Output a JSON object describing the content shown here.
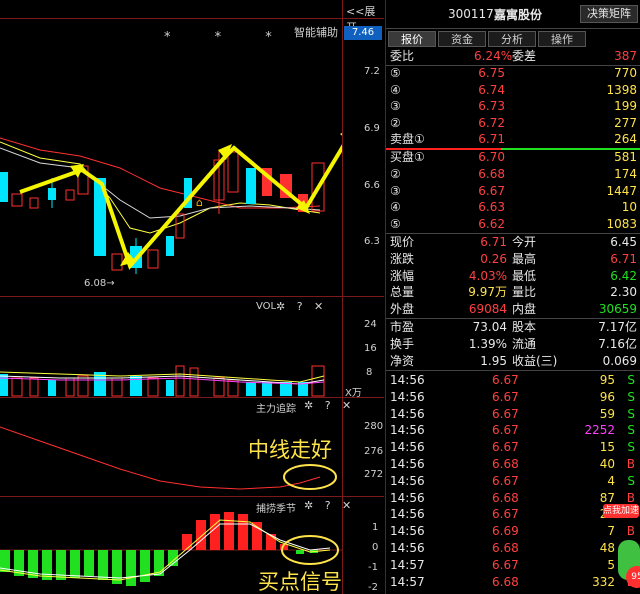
{
  "chart": {
    "expand_label": "<<展开",
    "smart_assist_label": "智能辅助",
    "current_price_badge": "7.46",
    "stars": "*  * *",
    "low_marker": "6.08→",
    "price_axis": [
      "7.2",
      "6.9",
      "6.6",
      "6.3"
    ],
    "vol_panel": {
      "title": "VOL",
      "axis": [
        "24",
        "16",
        "8"
      ],
      "unit": "X万"
    },
    "main_force_panel": {
      "title": "主力追踪",
      "axis": [
        "280",
        "276",
        "272"
      ]
    },
    "season_panel": {
      "title": "捕捞季节",
      "axis": [
        "1",
        "0",
        "-1",
        "-2"
      ]
    },
    "panel_icons": "✲ ? ✕",
    "annotation_midline": "中线走好",
    "annotation_buy": "买点信号",
    "colors": {
      "up": "#ff2a2a",
      "down": "#00e5ff",
      "ma_yellow": "#ffff40",
      "arrow": "#f5f500"
    }
  },
  "quote": {
    "code": "300117",
    "name": "嘉寓股份",
    "matrix_button": "决策矩阵",
    "tabs": [
      "报价",
      "资金",
      "分析",
      "操作"
    ],
    "commission": {
      "label1": "委比",
      "value1": "6.24%",
      "label2": "委差",
      "value2": "387"
    },
    "sell_orders": [
      {
        "label": "⑤",
        "price": "6.75",
        "vol": "770"
      },
      {
        "label": "④",
        "price": "6.74",
        "vol": "1398"
      },
      {
        "label": "③",
        "price": "6.73",
        "vol": "199"
      },
      {
        "label": "②",
        "price": "6.72",
        "vol": "277"
      },
      {
        "label": "卖盘①",
        "price": "6.71",
        "vol": "264"
      }
    ],
    "buy_orders": [
      {
        "label": "买盘①",
        "price": "6.70",
        "vol": "581"
      },
      {
        "label": "②",
        "price": "6.68",
        "vol": "174"
      },
      {
        "label": "③",
        "price": "6.67",
        "vol": "1447"
      },
      {
        "label": "④",
        "price": "6.63",
        "vol": "10"
      },
      {
        "label": "⑤",
        "price": "6.62",
        "vol": "1083"
      }
    ],
    "stats": [
      {
        "l1": "现价",
        "v1": "6.71",
        "c1": "red",
        "l2": "今开",
        "v2": "6.45",
        "c2": "white"
      },
      {
        "l1": "涨跌",
        "v1": "0.26",
        "c1": "red",
        "l2": "最高",
        "v2": "6.71",
        "c2": "red"
      },
      {
        "l1": "涨幅",
        "v1": "4.03%",
        "c1": "red",
        "l2": "最低",
        "v2": "6.42",
        "c2": "green"
      },
      {
        "l1": "总量",
        "v1": "9.97万",
        "c1": "yellow",
        "l2": "量比",
        "v2": "2.30",
        "c2": "white"
      },
      {
        "l1": "外盘",
        "v1": "69084",
        "c1": "red",
        "l2": "内盘",
        "v2": "30659",
        "c2": "green"
      }
    ],
    "stats2": [
      {
        "l1": "市盈",
        "v1": "73.04",
        "l2": "股本",
        "v2": "7.17亿"
      },
      {
        "l1": "换手",
        "v1": "1.39%",
        "l2": "流通",
        "v2": "7.16亿"
      },
      {
        "l1": "净资",
        "v1": "1.95",
        "l2": "收益(三)",
        "v2": "0.069"
      }
    ],
    "ticks": [
      {
        "time": "14:56",
        "price": "6.67",
        "vol": "95",
        "side": "S",
        "vc": "yellow"
      },
      {
        "time": "14:56",
        "price": "6.67",
        "vol": "96",
        "side": "S",
        "vc": "yellow"
      },
      {
        "time": "14:56",
        "price": "6.67",
        "vol": "59",
        "side": "S",
        "vc": "yellow"
      },
      {
        "time": "14:56",
        "price": "6.67",
        "vol": "2252",
        "side": "S",
        "vc": "magenta"
      },
      {
        "time": "14:56",
        "price": "6.67",
        "vol": "15",
        "side": "S",
        "vc": "yellow"
      },
      {
        "time": "14:56",
        "price": "6.68",
        "vol": "40",
        "side": "B",
        "vc": "yellow"
      },
      {
        "time": "14:56",
        "price": "6.67",
        "vol": "4",
        "side": "S",
        "vc": "yellow"
      },
      {
        "time": "14:56",
        "price": "6.68",
        "vol": "87",
        "side": "B",
        "vc": "yellow"
      },
      {
        "time": "14:56",
        "price": "6.67",
        "vol": "22",
        "side": "S",
        "vc": "yellow"
      },
      {
        "time": "14:56",
        "price": "6.69",
        "vol": "7",
        "side": "B",
        "vc": "yellow"
      },
      {
        "time": "14:56",
        "price": "6.68",
        "vol": "48",
        "side": "S",
        "vc": "yellow"
      },
      {
        "time": "14:57",
        "price": "6.67",
        "vol": "5",
        "side": "S",
        "vc": "yellow"
      },
      {
        "time": "14:57",
        "price": "6.68",
        "vol": "332",
        "side": "B",
        "vc": "yellow"
      }
    ],
    "badge_text": "点我加速",
    "badge_number": "95"
  }
}
